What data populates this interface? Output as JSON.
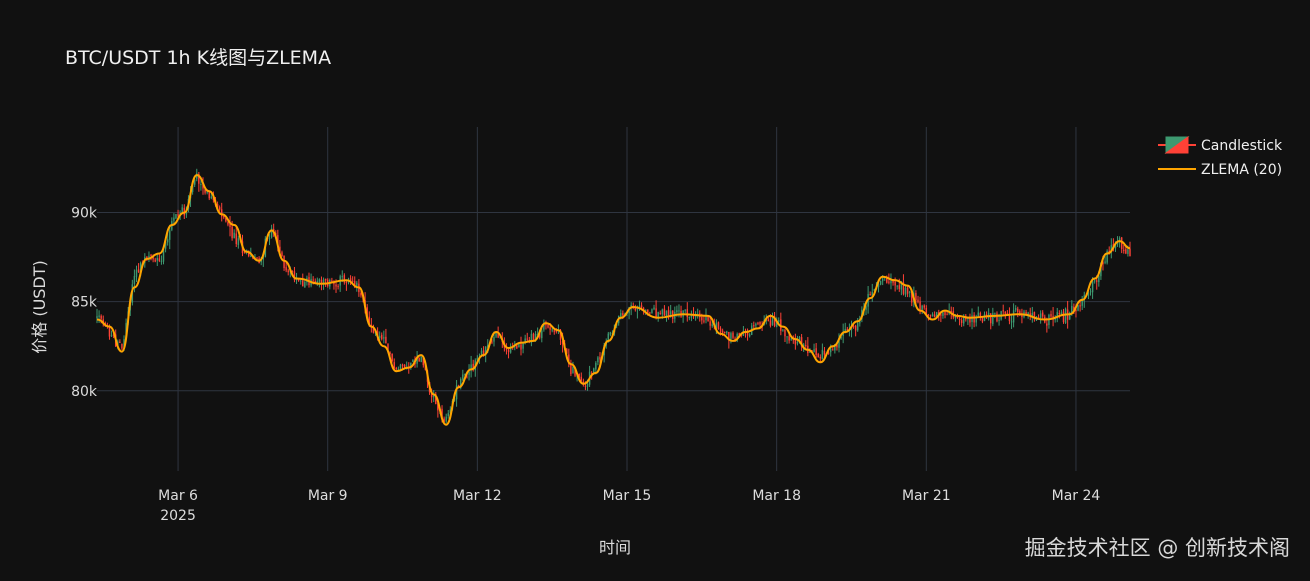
{
  "chart_data": {
    "type": "candlestick",
    "title": "BTC/USDT 1h K线图与ZLEMA",
    "xlabel": "时间",
    "ylabel": "价格 (USDT)",
    "x_ticks": [
      {
        "label": "Mar 6",
        "sub": "2025",
        "day": 6
      },
      {
        "label": "Mar 9",
        "day": 9
      },
      {
        "label": "Mar 12",
        "day": 12
      },
      {
        "label": "Mar 15",
        "day": 15
      },
      {
        "label": "Mar 18",
        "day": 18
      },
      {
        "label": "Mar 21",
        "day": 21
      },
      {
        "label": "Mar 24",
        "day": 24
      }
    ],
    "y_ticks": [
      {
        "label": "80k",
        "value": 80000
      },
      {
        "label": "85k",
        "value": 85000
      },
      {
        "label": "90k",
        "value": 90000
      }
    ],
    "x_range": [
      "2025-03-04 09:00",
      "2025-03-25 02:00"
    ],
    "ylim": [
      75500,
      94800
    ],
    "grid": true,
    "legend": {
      "position": "top-right",
      "entries": [
        "Candlestick",
        "ZLEMA (20)"
      ]
    },
    "colors": {
      "increasing": "#3d9970",
      "decreasing": "#ff4136",
      "zlema": "#ffa500",
      "grid": "#2f3540"
    },
    "price_path": [
      [
        "2025-03-04 09:00",
        84100
      ],
      [
        "2025-03-04 15:00",
        83300
      ],
      [
        "2025-03-04 21:00",
        82300
      ],
      [
        "2025-03-05 03:00",
        86600
      ],
      [
        "2025-03-05 09:00",
        87500
      ],
      [
        "2025-03-05 15:00",
        87300
      ],
      [
        "2025-03-05 21:00",
        89600
      ],
      [
        "2025-03-06 03:00",
        90200
      ],
      [
        "2025-03-06 09:00",
        92100
      ],
      [
        "2025-03-06 15:00",
        91000
      ],
      [
        "2025-03-06 21:00",
        89800
      ],
      [
        "2025-03-07 03:00",
        88600
      ],
      [
        "2025-03-07 09:00",
        87800
      ],
      [
        "2025-03-07 15:00",
        87200
      ],
      [
        "2025-03-07 21:00",
        89200
      ],
      [
        "2025-03-08 03:00",
        87000
      ],
      [
        "2025-03-08 09:00",
        86300
      ],
      [
        "2025-03-08 21:00",
        86000
      ],
      [
        "2025-03-09 09:00",
        86200
      ],
      [
        "2025-03-09 15:00",
        85700
      ],
      [
        "2025-03-09 21:00",
        83500
      ],
      [
        "2025-03-10 03:00",
        82700
      ],
      [
        "2025-03-10 09:00",
        81200
      ],
      [
        "2025-03-10 15:00",
        81500
      ],
      [
        "2025-03-10 21:00",
        81800
      ],
      [
        "2025-03-11 03:00",
        79500
      ],
      [
        "2025-03-11 09:00",
        78200
      ],
      [
        "2025-03-11 15:00",
        80500
      ],
      [
        "2025-03-11 21:00",
        81400
      ],
      [
        "2025-03-12 03:00",
        82200
      ],
      [
        "2025-03-12 09:00",
        83200
      ],
      [
        "2025-03-12 15:00",
        82200
      ],
      [
        "2025-03-12 21:00",
        82700
      ],
      [
        "2025-03-13 03:00",
        82900
      ],
      [
        "2025-03-13 09:00",
        83700
      ],
      [
        "2025-03-13 15:00",
        83200
      ],
      [
        "2025-03-13 21:00",
        81300
      ],
      [
        "2025-03-14 03:00",
        80300
      ],
      [
        "2025-03-14 09:00",
        81300
      ],
      [
        "2025-03-14 15:00",
        83000
      ],
      [
        "2025-03-14 21:00",
        84200
      ],
      [
        "2025-03-15 03:00",
        84600
      ],
      [
        "2025-03-15 15:00",
        84300
      ],
      [
        "2025-03-16 03:00",
        84300
      ],
      [
        "2025-03-16 15:00",
        84000
      ],
      [
        "2025-03-16 21:00",
        83400
      ],
      [
        "2025-03-17 03:00",
        83000
      ],
      [
        "2025-03-17 09:00",
        83300
      ],
      [
        "2025-03-17 15:00",
        83700
      ],
      [
        "2025-03-17 21:00",
        84000
      ],
      [
        "2025-03-18 03:00",
        83600
      ],
      [
        "2025-03-18 09:00",
        82800
      ],
      [
        "2025-03-18 15:00",
        82300
      ],
      [
        "2025-03-18 21:00",
        81800
      ],
      [
        "2025-03-19 03:00",
        82500
      ],
      [
        "2025-03-19 09:00",
        83200
      ],
      [
        "2025-03-19 15:00",
        83800
      ],
      [
        "2025-03-19 21:00",
        85400
      ],
      [
        "2025-03-20 03:00",
        86300
      ],
      [
        "2025-03-20 09:00",
        86200
      ],
      [
        "2025-03-20 15:00",
        85600
      ],
      [
        "2025-03-20 21:00",
        84800
      ],
      [
        "2025-03-21 03:00",
        84200
      ],
      [
        "2025-03-21 09:00",
        84300
      ],
      [
        "2025-03-21 15:00",
        84100
      ],
      [
        "2025-03-21 21:00",
        84000
      ],
      [
        "2025-03-22 09:00",
        84200
      ],
      [
        "2025-03-22 21:00",
        84300
      ],
      [
        "2025-03-23 09:00",
        84000
      ],
      [
        "2025-03-23 21:00",
        84300
      ],
      [
        "2025-03-24 03:00",
        85000
      ],
      [
        "2025-03-24 09:00",
        86200
      ],
      [
        "2025-03-24 15:00",
        87600
      ],
      [
        "2025-03-24 21:00",
        88300
      ],
      [
        "2025-03-25 02:00",
        87500
      ]
    ],
    "zlema": [
      [
        "2025-03-04 09:00",
        84000
      ],
      [
        "2025-03-04 15:00",
        83600
      ],
      [
        "2025-03-04 21:00",
        82200
      ],
      [
        "2025-03-05 03:00",
        85800
      ],
      [
        "2025-03-05 09:00",
        87400
      ],
      [
        "2025-03-05 15:00",
        87700
      ],
      [
        "2025-03-05 21:00",
        89300
      ],
      [
        "2025-03-06 03:00",
        90000
      ],
      [
        "2025-03-06 09:00",
        92100
      ],
      [
        "2025-03-06 15:00",
        91200
      ],
      [
        "2025-03-06 21:00",
        89900
      ],
      [
        "2025-03-07 03:00",
        89300
      ],
      [
        "2025-03-07 09:00",
        87800
      ],
      [
        "2025-03-07 15:00",
        87300
      ],
      [
        "2025-03-07 21:00",
        89000
      ],
      [
        "2025-03-08 03:00",
        87300
      ],
      [
        "2025-03-08 09:00",
        86300
      ],
      [
        "2025-03-08 21:00",
        86000
      ],
      [
        "2025-03-09 09:00",
        86200
      ],
      [
        "2025-03-09 15:00",
        85800
      ],
      [
        "2025-03-09 21:00",
        83600
      ],
      [
        "2025-03-10 03:00",
        82500
      ],
      [
        "2025-03-10 09:00",
        81100
      ],
      [
        "2025-03-10 15:00",
        81300
      ],
      [
        "2025-03-10 21:00",
        82000
      ],
      [
        "2025-03-11 03:00",
        79800
      ],
      [
        "2025-03-11 09:00",
        78100
      ],
      [
        "2025-03-11 15:00",
        80200
      ],
      [
        "2025-03-11 21:00",
        81200
      ],
      [
        "2025-03-12 03:00",
        82000
      ],
      [
        "2025-03-12 09:00",
        83300
      ],
      [
        "2025-03-12 15:00",
        82400
      ],
      [
        "2025-03-12 21:00",
        82700
      ],
      [
        "2025-03-13 03:00",
        82800
      ],
      [
        "2025-03-13 09:00",
        83800
      ],
      [
        "2025-03-13 15:00",
        83400
      ],
      [
        "2025-03-13 21:00",
        81500
      ],
      [
        "2025-03-14 03:00",
        80400
      ],
      [
        "2025-03-14 09:00",
        81000
      ],
      [
        "2025-03-14 15:00",
        82800
      ],
      [
        "2025-03-14 21:00",
        84100
      ],
      [
        "2025-03-15 03:00",
        84700
      ],
      [
        "2025-03-15 15:00",
        84100
      ],
      [
        "2025-03-16 03:00",
        84300
      ],
      [
        "2025-03-16 15:00",
        84200
      ],
      [
        "2025-03-16 21:00",
        83200
      ],
      [
        "2025-03-17 03:00",
        82800
      ],
      [
        "2025-03-17 09:00",
        83300
      ],
      [
        "2025-03-17 15:00",
        83500
      ],
      [
        "2025-03-17 21:00",
        84200
      ],
      [
        "2025-03-18 03:00",
        83600
      ],
      [
        "2025-03-18 09:00",
        82900
      ],
      [
        "2025-03-18 15:00",
        82300
      ],
      [
        "2025-03-18 21:00",
        81600
      ],
      [
        "2025-03-19 03:00",
        82500
      ],
      [
        "2025-03-19 09:00",
        83300
      ],
      [
        "2025-03-19 15:00",
        83900
      ],
      [
        "2025-03-19 21:00",
        85200
      ],
      [
        "2025-03-20 03:00",
        86400
      ],
      [
        "2025-03-20 09:00",
        86200
      ],
      [
        "2025-03-20 15:00",
        85900
      ],
      [
        "2025-03-20 21:00",
        84500
      ],
      [
        "2025-03-21 03:00",
        84000
      ],
      [
        "2025-03-21 09:00",
        84500
      ],
      [
        "2025-03-21 15:00",
        84200
      ],
      [
        "2025-03-21 21:00",
        84100
      ],
      [
        "2025-03-22 09:00",
        84200
      ],
      [
        "2025-03-22 21:00",
        84300
      ],
      [
        "2025-03-23 09:00",
        84000
      ],
      [
        "2025-03-23 21:00",
        84300
      ],
      [
        "2025-03-24 03:00",
        85100
      ],
      [
        "2025-03-24 09:00",
        86300
      ],
      [
        "2025-03-24 15:00",
        87700
      ],
      [
        "2025-03-24 21:00",
        88400
      ],
      [
        "2025-03-25 02:00",
        88000
      ]
    ]
  },
  "watermark": "掘金技术社区 @ 创新技术阁"
}
